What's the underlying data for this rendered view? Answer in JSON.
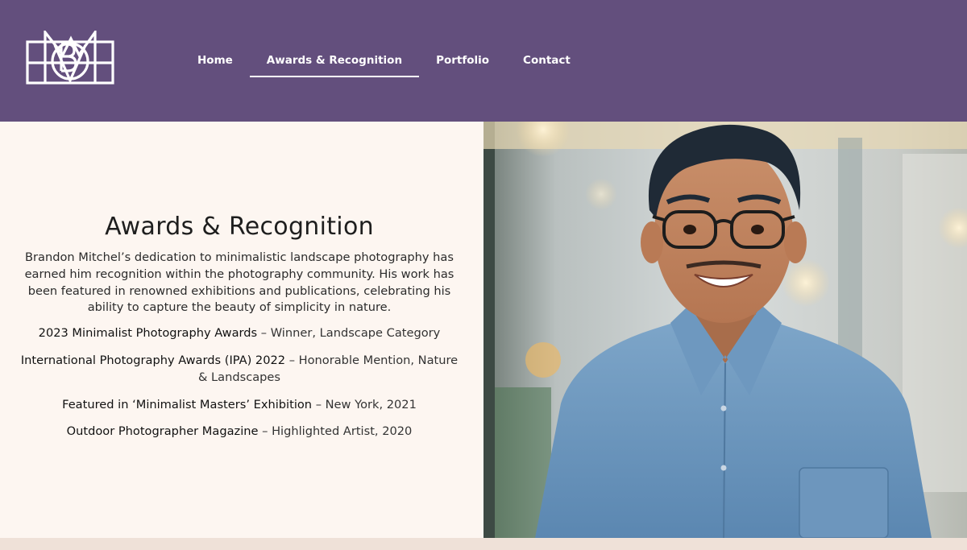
{
  "header": {
    "logo_alt": "BM monogram logo",
    "nav": [
      {
        "label": "Home",
        "active": false
      },
      {
        "label": "Awards & Recognition",
        "active": true
      },
      {
        "label": "Portfolio",
        "active": false
      },
      {
        "label": "Contact",
        "active": false
      }
    ]
  },
  "main": {
    "title": "Awards & Recognition",
    "intro": "Brandon Mitchel’s dedication to minimalistic landscape photography has earned him recognition within the photography community. His work has been featured in renowned exhibitions and publications, celebrating his ability to capture the beauty of simplicity in nature.",
    "awards": [
      {
        "name": "2023 Minimalist Photography Awards",
        "detail": " – Winner, Landscape Category"
      },
      {
        "name": "International Photography Awards (IPA) 2022",
        "detail": " – Honorable Mention, Nature & Landscapes"
      },
      {
        "name": "Featured in ‘Minimalist Masters’ Exhibition",
        "detail": " – New York, 2021"
      },
      {
        "name": "Outdoor Photographer Magazine",
        "detail": " – Highlighted Artist, 2020"
      }
    ],
    "photo_alt": "Portrait of smiling man with glasses in blue shirt"
  },
  "colors": {
    "header_bg": "#634f7d",
    "content_bg": "#fdf6f1",
    "footer_bg": "#efe1d8"
  }
}
